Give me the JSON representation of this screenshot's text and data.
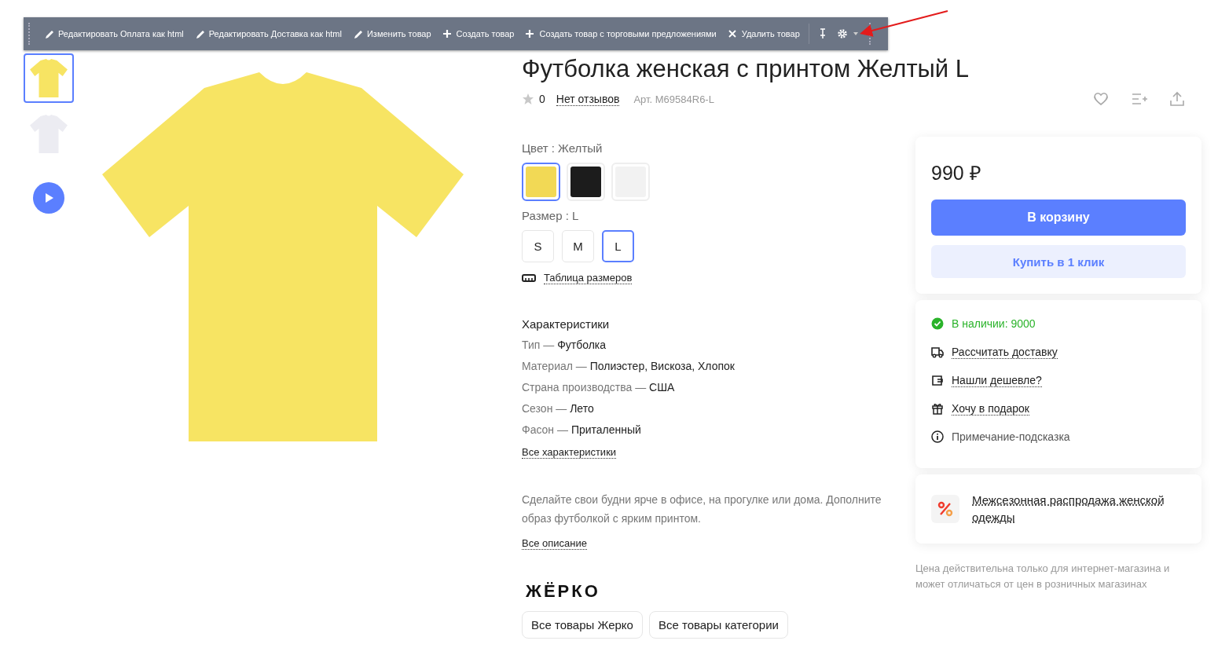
{
  "admin_toolbar": {
    "items": [
      {
        "kind": "edit",
        "label": "Редактировать Оплата как html"
      },
      {
        "kind": "edit",
        "label": "Редактировать Доставка как html"
      },
      {
        "kind": "edit",
        "label": "Изменить товар"
      },
      {
        "kind": "add",
        "label": "Создать товар"
      },
      {
        "kind": "add",
        "label": "Создать товар с торговыми предложениями"
      },
      {
        "kind": "delete",
        "label": "Удалить товар"
      }
    ]
  },
  "gallery": {
    "thumbnails": [
      {
        "kind": "photo",
        "color": "#f7e463",
        "selected": true
      },
      {
        "kind": "photo",
        "color": "#ececf2",
        "selected": false
      },
      {
        "kind": "video",
        "selected": false
      }
    ]
  },
  "product": {
    "title": "Футболка женская с принтом Желтый L",
    "rating": "0",
    "reviews": "Нет отзывов",
    "sku": "Арт. M69584R6-L"
  },
  "color_label": "Цвет : Желтый",
  "colors": [
    {
      "color": "#f2d955",
      "selected": true
    },
    {
      "color": "#1c1c1c",
      "selected": false
    },
    {
      "color": "#f2f2f2",
      "selected": false
    }
  ],
  "size_label": "Размер : L",
  "sizes": [
    {
      "label": "S",
      "selected": false
    },
    {
      "label": "M",
      "selected": false
    },
    {
      "label": "L",
      "selected": true
    }
  ],
  "size_table": "Таблица размеров",
  "characteristics": {
    "title": "Характеристики",
    "separator": "—",
    "rows": [
      {
        "name": "Тип",
        "value": "Футболка"
      },
      {
        "name": "Материал",
        "value": "Полиэстер, Вискоза, Хлопок"
      },
      {
        "name": "Страна производства",
        "value": "США"
      },
      {
        "name": "Сезон",
        "value": "Лето"
      },
      {
        "name": "Фасон",
        "value": "Приталенный"
      }
    ],
    "link": "Все характеристики"
  },
  "description": {
    "text": "Сделайте свои будни ярче в офисе, на прогулке или дома. Дополните образ футболкой с ярким принтом.",
    "link": "Все описание"
  },
  "brand": {
    "logo": "ЖЁРКО",
    "buttons": [
      "Все товары Жерко",
      "Все товары категории"
    ]
  },
  "buy_box": {
    "price": "990 ₽",
    "buttons": [
      {
        "kind": "primary",
        "label": "В корзину"
      },
      {
        "kind": "secondary",
        "label": "Купить в 1 клик"
      }
    ]
  },
  "info_box": [
    {
      "kind": "stock",
      "label": "В наличии: 9000"
    },
    {
      "kind": "delivery",
      "label": "Рассчитать доставку"
    },
    {
      "kind": "cheaper",
      "label": "Нашли дешевле?"
    },
    {
      "kind": "gift",
      "label": "Хочу в подарок"
    },
    {
      "kind": "hint",
      "label": "Примечание-подсказка"
    }
  ],
  "promo": {
    "label": "Межсезонная распродажа женской одежды"
  },
  "price_note": "Цена действительна только для интернет-магазина и может отличаться от цен в розничных магазинах"
}
